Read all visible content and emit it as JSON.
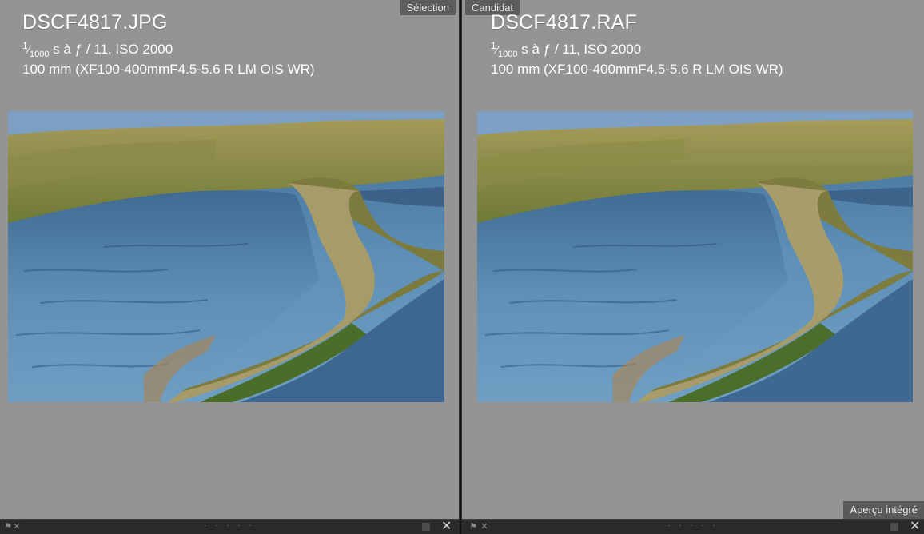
{
  "left": {
    "tag": "Sélection",
    "filename": "DSCF4817.JPG",
    "exposure_num": "1",
    "exposure_den": "1000",
    "exposure_rest": "s à ƒ / 11, ISO 2000",
    "lens": "100 mm (XF100-400mmF4.5-5.6 R LM OIS WR)"
  },
  "right": {
    "tag": "Candidat",
    "filename": "DSCF4817.RAF",
    "exposure_num": "1",
    "exposure_den": "1000",
    "exposure_rest": "s à ƒ / 11, ISO 2000",
    "lens": "100 mm (XF100-400mmF4.5-5.6 R LM OIS WR)",
    "preview_badge": "Aperçu intégré"
  },
  "bottom": {
    "dots": "· · · · ·",
    "close_glyph": "✕"
  },
  "icons": [
    "flag-icon",
    "reject-icon",
    "close-icon",
    "grid-square-icon"
  ],
  "colors": {
    "pane_bg": "#949494",
    "tag_bg": "#5d5d5d",
    "bar_bg": "#2a2a2a"
  }
}
